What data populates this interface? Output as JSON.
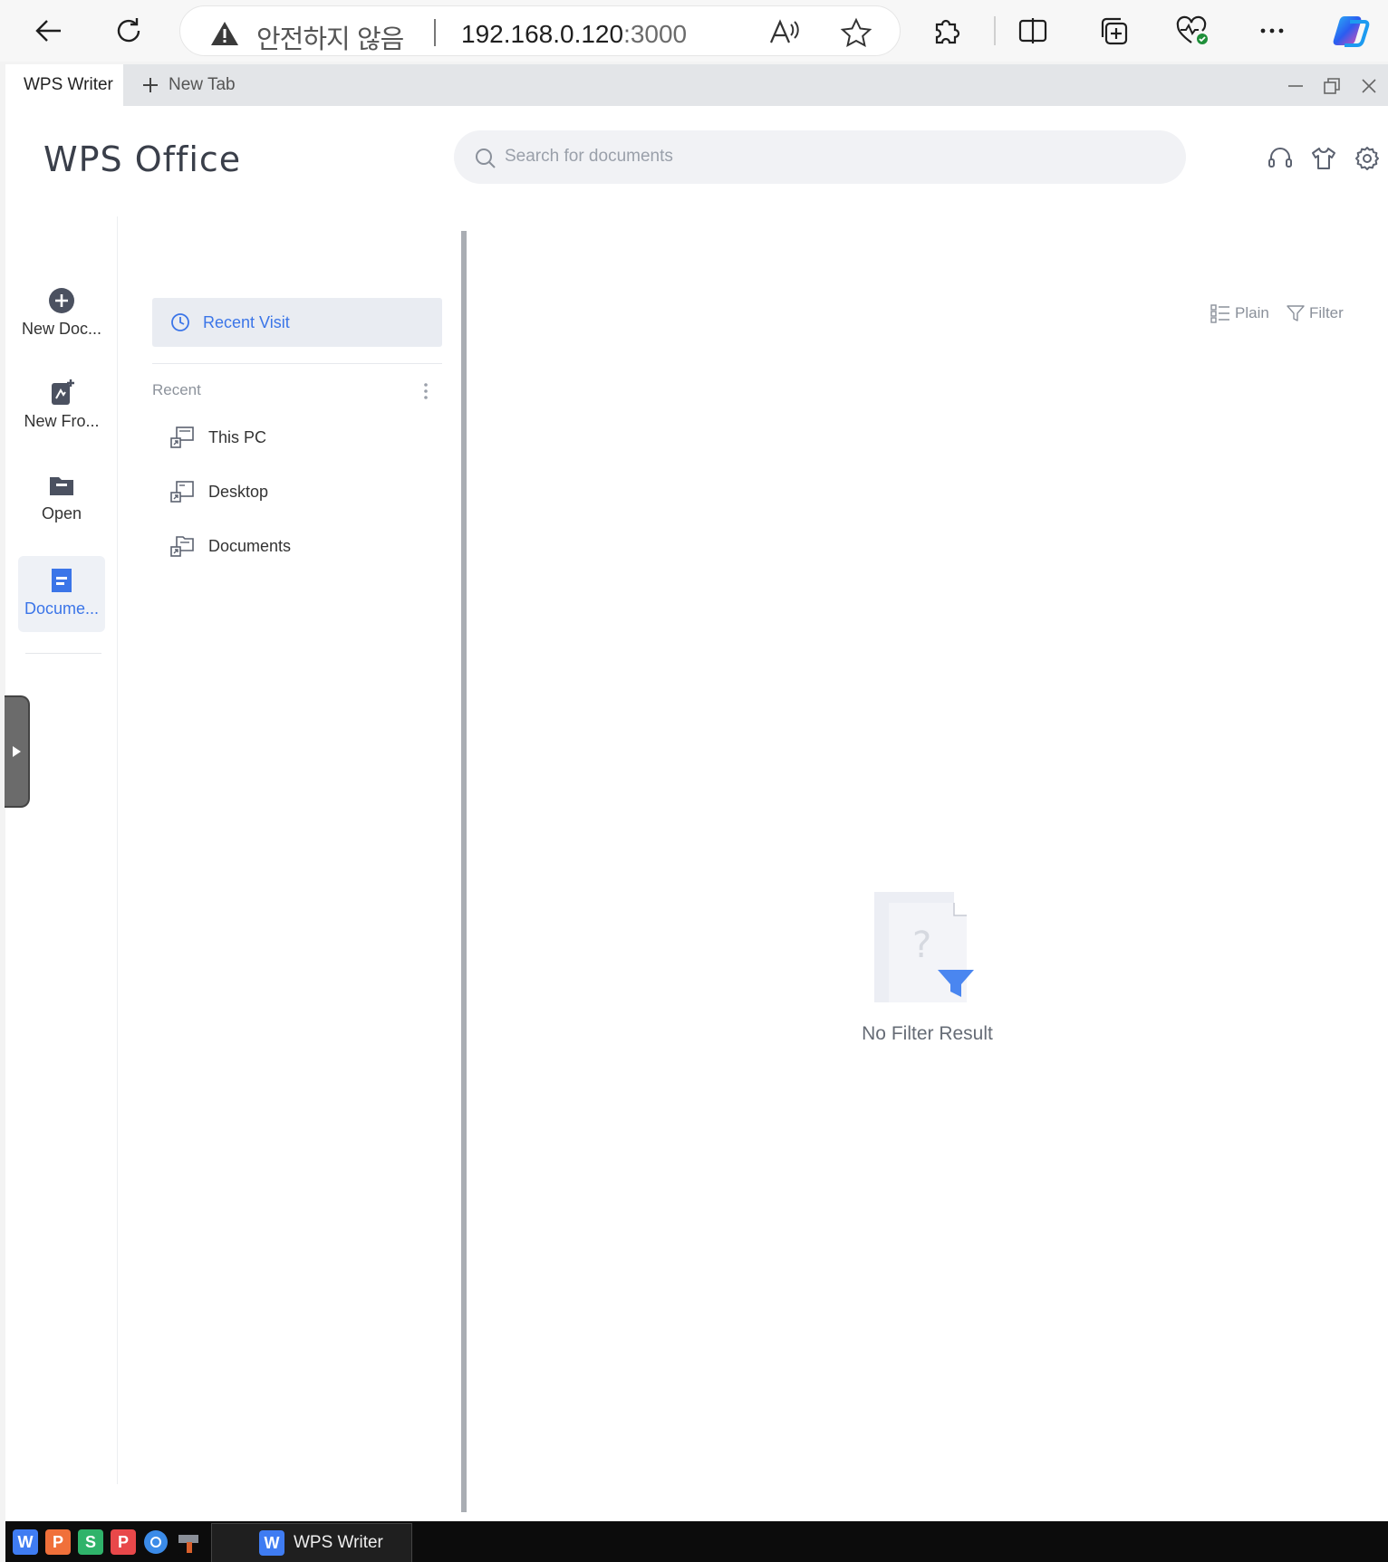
{
  "browser": {
    "security_label": "안전하지 않음",
    "url_host": "192.168.0.120",
    "url_port": ":3000"
  },
  "window": {
    "tabs": [
      {
        "label": "WPS Writer"
      },
      {
        "label": "New Tab"
      }
    ]
  },
  "app": {
    "logo": "WPS Office",
    "search_placeholder": "Search for documents"
  },
  "leftnav": {
    "items": [
      {
        "label": "New Doc...",
        "icon": "plus-circle-icon"
      },
      {
        "label": "New Fro...",
        "icon": "new-from-template-icon"
      },
      {
        "label": "Open",
        "icon": "folder-icon"
      },
      {
        "label": "Docume...",
        "icon": "document-icon",
        "active": true
      }
    ]
  },
  "subcol": {
    "recent_visit": "Recent Visit",
    "recent_header": "Recent",
    "locations": [
      {
        "label": "This PC"
      },
      {
        "label": "Desktop"
      },
      {
        "label": "Documents"
      }
    ]
  },
  "main": {
    "plain_label": "Plain",
    "filter_label": "Filter",
    "empty_text": "No Filter Result"
  },
  "taskbar": {
    "task_label": "WPS Writer",
    "apps": [
      "W",
      "P",
      "S",
      "P"
    ]
  },
  "colors": {
    "accent": "#3b75e8",
    "active_bg": "#eef1f6"
  }
}
